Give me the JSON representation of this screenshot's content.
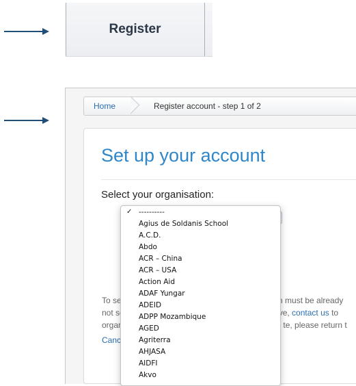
{
  "tab": {
    "register_label": "Register"
  },
  "breadcrumb": {
    "home": "Home",
    "current": "Register account - step 1 of 2"
  },
  "card": {
    "title": "Set up your account",
    "select_label": "Select your organisation:"
  },
  "info": {
    "line1_a": "To set",
    "line1_b": "n must be already",
    "line2_a": "not se",
    "line2_b": "ve, ",
    "line2_link": "contact us",
    "line2_c": " to",
    "line3_a": "organis",
    "line3_b": "te, please return t"
  },
  "cancel_label": "Cancel",
  "dropdown": {
    "selected": "----------",
    "options": [
      "----------",
      "Agius de Soldanis School",
      "A.C.D.",
      "Abdo",
      "ACR – China",
      "ACR – USA",
      "Action Aid",
      "ADAF Yungar",
      "ADEID",
      "ADPP Mozambique",
      "AGED",
      "Agriterra",
      "AHJASA",
      "AIDFI",
      "Akvo"
    ]
  },
  "colors": {
    "arrow": "#1f4e79",
    "accent": "#2f86c8",
    "link": "#2a6fb0"
  },
  "icons": {
    "check": "checkmark-icon",
    "arrow": "arrow-right-icon"
  }
}
